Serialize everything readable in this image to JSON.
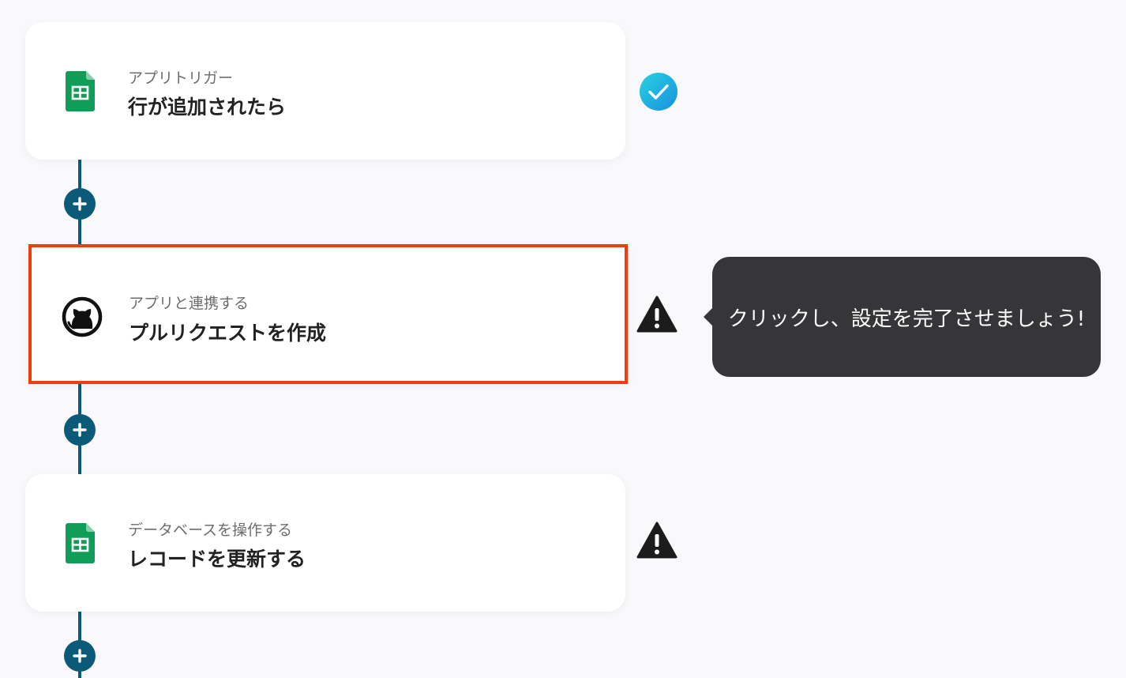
{
  "steps": [
    {
      "app_icon": "google-sheets-icon",
      "subtitle": "アプリトリガー",
      "title": "行が追加されたら",
      "status": "complete",
      "status_icon": "check-circle-icon"
    },
    {
      "app_icon": "github-icon",
      "subtitle": "アプリと連携する",
      "title": "プルリクエストを作成",
      "status": "warning",
      "status_icon": "warning-icon",
      "selected": true
    },
    {
      "app_icon": "google-sheets-icon",
      "subtitle": "データベースを操作する",
      "title": "レコードを更新する",
      "status": "warning",
      "status_icon": "warning-icon"
    }
  ],
  "tooltip": {
    "text": "クリックし、設定を完了させましょう!"
  },
  "colors": {
    "background": "#f9f8fb",
    "connector": "#0b5a78",
    "highlight_border": "#f13c0e",
    "check_gradient_start": "#27d3e0",
    "check_gradient_end": "#1a8fe0",
    "tooltip_bg": "#363538",
    "sheets_green": "#0f9d58"
  }
}
